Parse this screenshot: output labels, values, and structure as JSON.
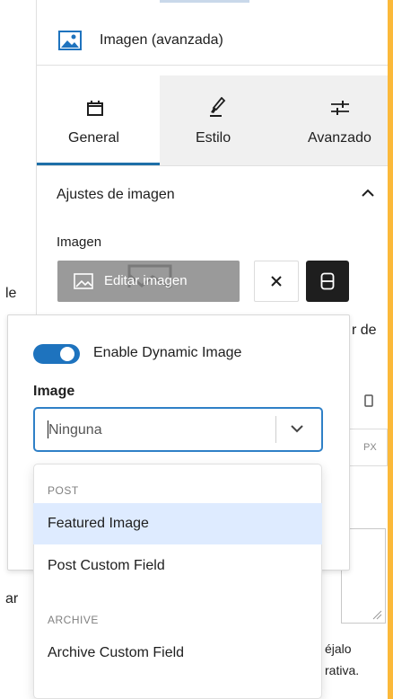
{
  "block": {
    "title": "Imagen (avanzada)"
  },
  "tabs": [
    {
      "label": "General"
    },
    {
      "label": "Estilo"
    },
    {
      "label": "Avanzado"
    }
  ],
  "section": {
    "title": "Ajustes de imagen"
  },
  "image_field": {
    "label": "Imagen",
    "edit_button": "Editar imagen"
  },
  "background_fragments": {
    "left1": "le",
    "left2": "ar",
    "right1": "r de",
    "right_px": "PX",
    "right_hint1": "éjalo",
    "right_hint2": "rativa."
  },
  "dynamic": {
    "toggle_label": "Enable Dynamic Image",
    "toggle_on": true,
    "select_label": "Image",
    "select_value": "Ninguna"
  },
  "dropdown": {
    "groups": [
      {
        "label": "POST",
        "options": [
          "Featured Image",
          "Post Custom Field"
        ]
      },
      {
        "label": "ARCHIVE",
        "options": [
          "Archive Custom Field"
        ]
      }
    ],
    "highlighted": "Featured Image"
  },
  "colors": {
    "accent": "#1e73be",
    "page_bg": "#fbb93a",
    "highlight": "#deebff"
  }
}
